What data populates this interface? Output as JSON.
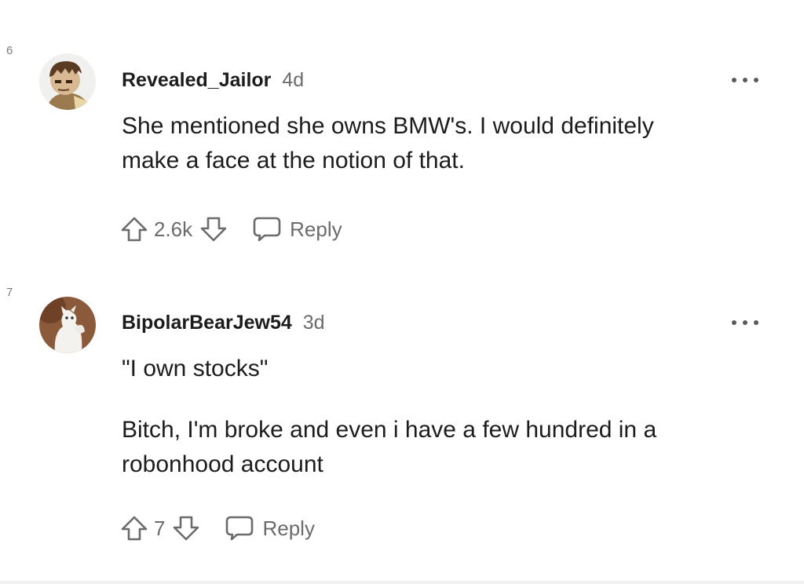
{
  "comments": [
    {
      "line_number": "6",
      "username": "Revealed_Jailor",
      "time": "4d",
      "body": [
        "She mentioned she owns BMW's. I would definitely make a face at the notion of that."
      ],
      "score": "2.6k",
      "reply_label": "Reply",
      "avatar_icon": "cartoon-character-avatar"
    },
    {
      "line_number": "7",
      "username": "BipolarBearJew54",
      "time": "3d",
      "body": [
        "\"I own stocks\"",
        "Bitch, I'm broke and even i have a few hundred in a robonhood account"
      ],
      "score": "7",
      "reply_label": "Reply",
      "avatar_icon": "white-cat-avatar"
    }
  ],
  "colors": {
    "text": "#1c1c1c",
    "meta": "#6b6b6b",
    "line_number": "#7c7c7c"
  }
}
